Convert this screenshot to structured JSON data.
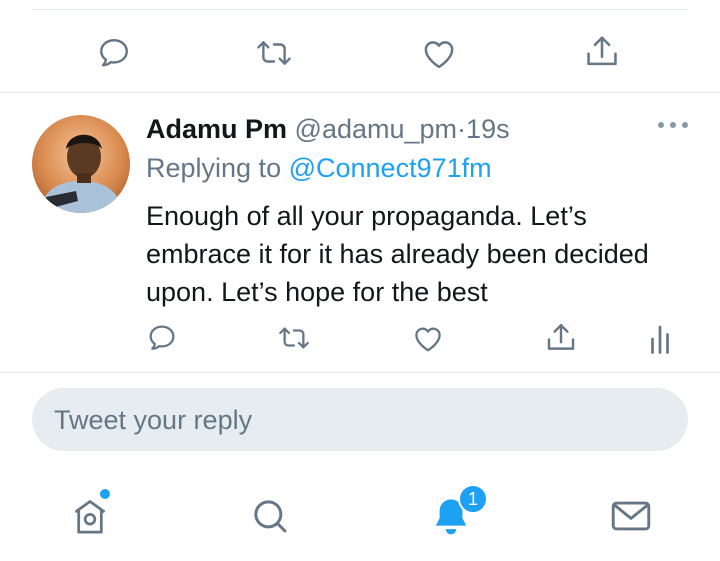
{
  "colors": {
    "accent": "#1da1f2",
    "icon_gray": "#657786",
    "text": "#14171a",
    "reply_box_bg": "#e6ecf0"
  },
  "top_actions": {
    "icons": [
      "reply-icon",
      "retweet-icon",
      "like-icon",
      "share-icon"
    ]
  },
  "tweet": {
    "author_name": "Adamu Pm",
    "author_handle": "@adamu_pm",
    "separator": "·",
    "time": "19s",
    "replying_prefix": "Replying to ",
    "replying_to": "@Connect971fm",
    "text": "Enough of all your propaganda. Let’s embrace it for it has already been decided upon. Let’s hope for the best",
    "actions": [
      "reply-icon",
      "retweet-icon",
      "like-icon",
      "share-icon",
      "analytics-icon"
    ]
  },
  "reply_box": {
    "placeholder": "Tweet your reply"
  },
  "tabbar": {
    "tabs": [
      "home-icon",
      "search-icon",
      "notifications-icon",
      "messages-icon"
    ],
    "notifications_badge": "1"
  }
}
